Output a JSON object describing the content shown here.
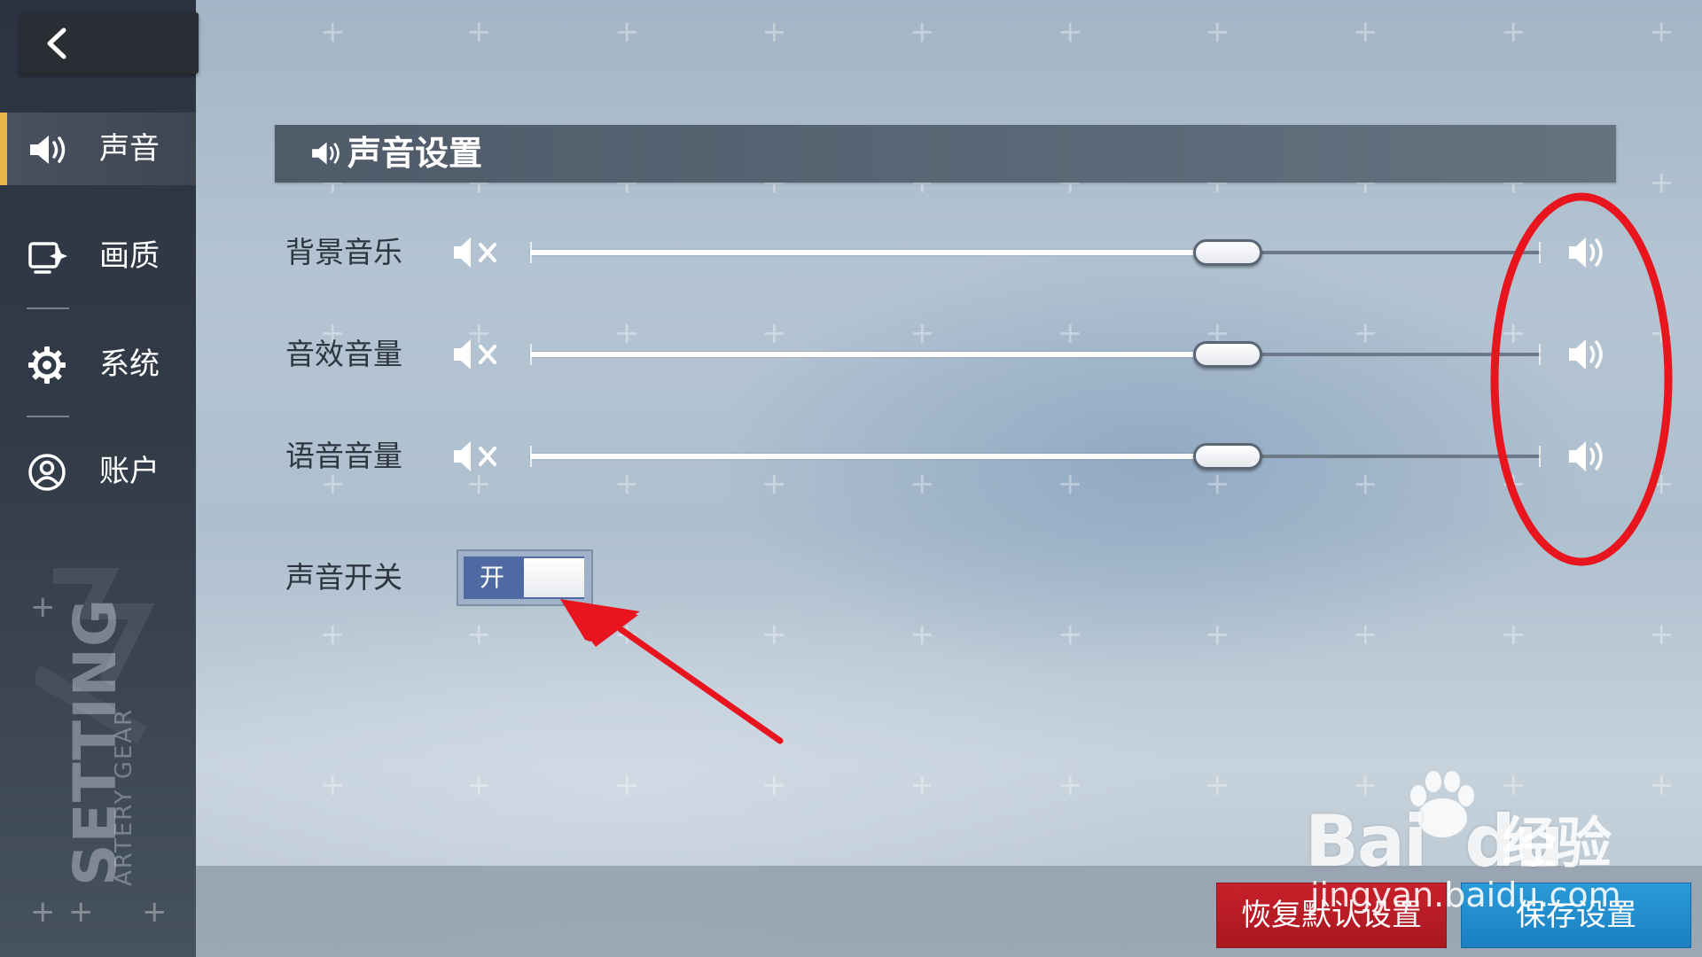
{
  "sidebar": {
    "back_icon": "chevron-left-icon",
    "items": [
      {
        "label": "声音",
        "icon": "speaker-icon",
        "active": true
      },
      {
        "label": "画质",
        "icon": "display-sparkle-icon",
        "active": false
      },
      {
        "label": "系统",
        "icon": "gear-icon",
        "active": false
      },
      {
        "label": "账户",
        "icon": "user-circle-icon",
        "active": false
      }
    ],
    "brand_text": "SETTING",
    "brand_subtext": "ARTERY GEAR"
  },
  "section": {
    "icon": "speaker-icon",
    "title": "声音设置"
  },
  "sliders": [
    {
      "label": "背景音乐",
      "value": 0.69,
      "min_icon": "mute-icon",
      "max_icon": "speaker-max-icon"
    },
    {
      "label": "音效音量",
      "value": 0.69,
      "min_icon": "mute-icon",
      "max_icon": "speaker-max-icon"
    },
    {
      "label": "语音音量",
      "value": 0.69,
      "min_icon": "mute-icon",
      "max_icon": "speaker-max-icon"
    }
  ],
  "sound_toggle": {
    "label": "声音开关",
    "state_label": "开",
    "on": true
  },
  "buttons": {
    "reset": "恢复默认设置",
    "save": "保存设置"
  },
  "watermark": {
    "brand": "Bai",
    "brand_du": "du",
    "brand_cn": "经验",
    "url": "jingyan.baidu.com"
  },
  "annotations": {
    "color": "#e8141e"
  },
  "colors": {
    "accent_active": "#e9b44a",
    "toggle_on": "#4f6aa3",
    "reset_button": "#c8202a",
    "save_button": "#2a9ad8"
  }
}
